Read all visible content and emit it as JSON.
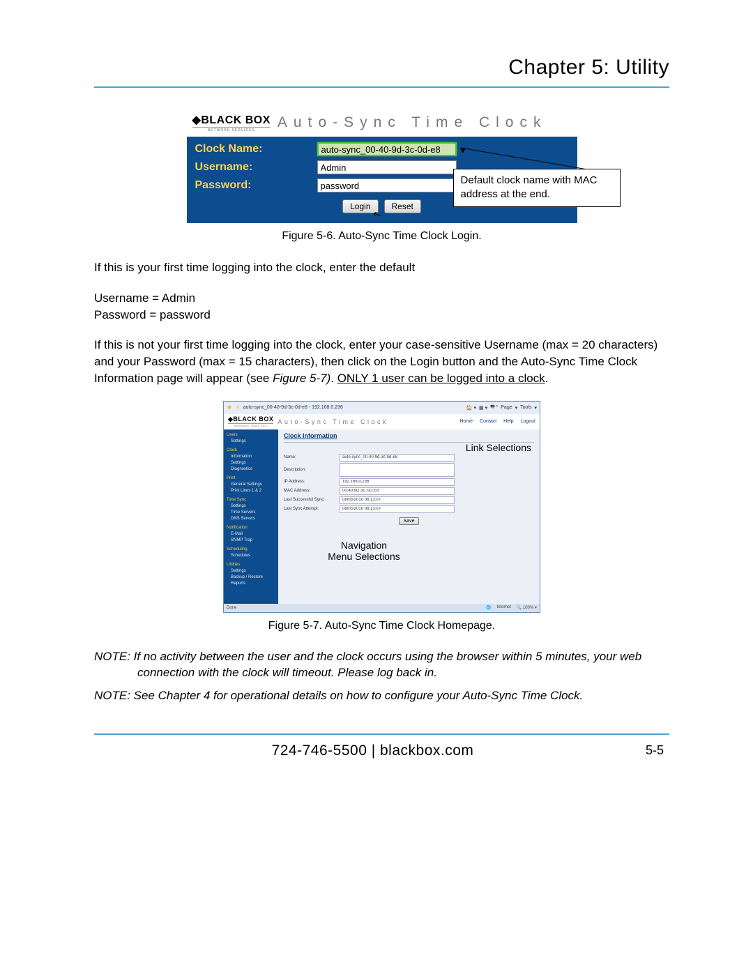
{
  "chapter": "Chapter 5: Utility",
  "login_panel": {
    "logo_main": "BLACK BOX",
    "logo_sub": "NETWORK SERVICES",
    "product": "Auto-Sync Time Clock",
    "rows": {
      "clock_name": {
        "label": "Clock Name:",
        "value": "auto-sync_00-40-9d-3c-0d-e8"
      },
      "username": {
        "label": "Username:",
        "value": "Admin"
      },
      "password": {
        "label": "Password:",
        "value": "password"
      }
    },
    "buttons": {
      "login": "Login",
      "reset": "Reset"
    },
    "callout": "Default clock name with MAC address at the end."
  },
  "caption1": "Figure 5-6.  Auto-Sync Time Clock Login.",
  "para1": "If this is your first time logging into the clock, enter the default",
  "creds": {
    "user_line": "Username = Admin",
    "pass_line": "Password = password"
  },
  "para2_a": "If this is not your first time logging into the clock, enter your case-sensitive Username (max = 20 characters) and your Password (max = 15 characters), then click on the Login button and the Auto-Sync Time Clock Information page will appear (see ",
  "para2_fig": "Figure 5-7)",
  "para2_b": ". ",
  "para2_u": "ONLY 1 user can be logged into a clock",
  "para2_c": ".",
  "homepage": {
    "toolbar": {
      "tab": "auto-sync_00-40-9d-3c-0d-e8 - 192.168.0.236",
      "right": [
        "Page",
        "Tools"
      ]
    },
    "links": [
      "Home",
      "Contact",
      "Help",
      "Logout"
    ],
    "sidebar": [
      {
        "header": "Users",
        "items": [
          "Settings"
        ]
      },
      {
        "header": "Clock",
        "items": [
          "Information",
          "Settings",
          "Diagnostics"
        ]
      },
      {
        "header": "Print",
        "items": [
          "General Settings",
          "Print Lines 1 & 2"
        ]
      },
      {
        "header": "Time Sync",
        "items": [
          "Settings",
          "Time Servers",
          "DNS Servers"
        ]
      },
      {
        "header": "Notification",
        "items": [
          "E-Mail",
          "SNMP Trap"
        ]
      },
      {
        "header": "Scheduling",
        "items": [
          "Schedules"
        ]
      },
      {
        "header": "Utilities",
        "items": [
          "Settings",
          "Backup / Restore",
          "Reports"
        ]
      }
    ],
    "content_title": "Clock Information",
    "info": {
      "name_label": "Name:",
      "name_value": "auto-sync_00-40-9d-3c-0d-e8",
      "desc_label": "Description:",
      "desc_value": "",
      "ip_label": "IP Address:",
      "ip_value": "192.168.0.236",
      "mac_label": "MAC Address:",
      "mac_value": "00:40:9D:3C:0D:E8",
      "lss_label": "Last Successful Sync:",
      "lss_value": "08/05/2010 06:13:07",
      "lsa_label": "Last Sync Attempt:",
      "lsa_value": "08/05/2010 06:13:07"
    },
    "save": "Save",
    "status": {
      "left": "Done",
      "mid": "Internet",
      "zoom": "100%"
    },
    "annotations": {
      "links": "Link Selections",
      "nav1": "Navigation",
      "nav2": "Menu Selections"
    }
  },
  "caption2": "Figure 5-7.  Auto-Sync Time Clock Homepage.",
  "note1": "NOTE:  If no activity between the user and the clock occurs using the browser within 5 minutes, your web connection with the clock will timeout. Please log back in.",
  "note2": "NOTE:  See Chapter 4 for operational details on how to configure your Auto-Sync Time Clock.",
  "footer": {
    "center": "724-746-5500   |   blackbox.com",
    "right": "5-5"
  }
}
